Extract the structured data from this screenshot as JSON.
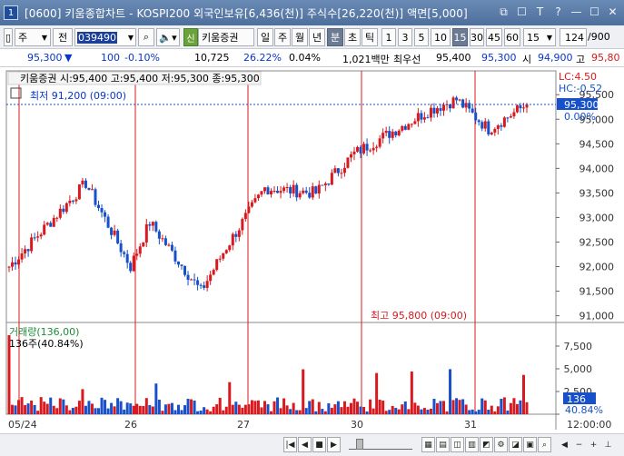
{
  "window": {
    "num": "1",
    "title": "[0600] 키움종합차트 - KOSPI200 외국인보유[6,436(천)] 주식수[26,220(천)] 액면[5,000]",
    "icons": [
      "window-icon",
      "pin-icon",
      "font-icon",
      "help-icon",
      "minimize-icon",
      "maximize-icon",
      "close-icon"
    ],
    "icon_glyphs": [
      "⧉",
      "☐",
      "T",
      "?",
      "—",
      "☐",
      "✕"
    ]
  },
  "toolbar": {
    "type_select": "주",
    "market_select": "전",
    "code_value": "039490",
    "search_glyph": "🔍",
    "stock_tag": "신",
    "stock_name": "키움증권",
    "periods": [
      "일",
      "주",
      "월",
      "년",
      "분",
      "초",
      "틱"
    ],
    "active_period": "분",
    "intervals": [
      "1",
      "3",
      "5",
      "10",
      "15",
      "30",
      "45",
      "60"
    ],
    "active_interval": "15",
    "interval_select": "15",
    "count_value": "124",
    "count_total": "/900"
  },
  "price_bar": {
    "price": "95,300",
    "change_arrow": "▼",
    "change": "100",
    "change_pct": "-0.10%",
    "volume": "10,725",
    "turnover_pct": "26.22%",
    "rate": "0.04%",
    "amount": "1,021백만",
    "priority_label": "최우선",
    "ask": "95,400",
    "bid": "95,300",
    "open_label": "시",
    "open": "94,900",
    "high_label": "고",
    "high": "95,80"
  },
  "chart_info": {
    "header": "키움증권 시:95,400 고:95,400 저:95,300 종:95,300",
    "low_marker": "최저 91,200 (09:00)",
    "high_marker": "최고 95,800 (09:00)",
    "lc": "LC:4.50",
    "hc": "HC:-0.52",
    "current_label": "95,300",
    "current_pct": "0.00%"
  },
  "volume_info": {
    "title": "거래량(136,00)",
    "max_label": "136주(40.84%)",
    "current_label": "136",
    "current_pct": "40.84%"
  },
  "x_axis": {
    "labels": [
      "05/24",
      "26",
      "27",
      "30",
      "31"
    ],
    "time_label": "12:00:00"
  },
  "chart_data": {
    "type": "candlestick",
    "title": "키움증권",
    "price_axis": [
      "95,500",
      "95,000",
      "94,500",
      "94,000",
      "93,500",
      "93,000",
      "92,500",
      "92,000",
      "91,500",
      "91,000"
    ],
    "price_ylim": [
      90900,
      95800
    ],
    "volume_axis": [
      "7,500",
      "5,000",
      "2,500",
      "0"
    ],
    "volume_ylim": [
      0,
      9000
    ],
    "sessions": [
      "05/24",
      "26",
      "27",
      "30",
      "31"
    ],
    "low": 91200,
    "high": 95800,
    "last": {
      "open": 95400,
      "high": 95400,
      "low": 95300,
      "close": 95300
    },
    "colors": {
      "up": "#d8191f",
      "down": "#1750c9",
      "grid": "#cfcfcf",
      "axis": "#888888"
    }
  }
}
